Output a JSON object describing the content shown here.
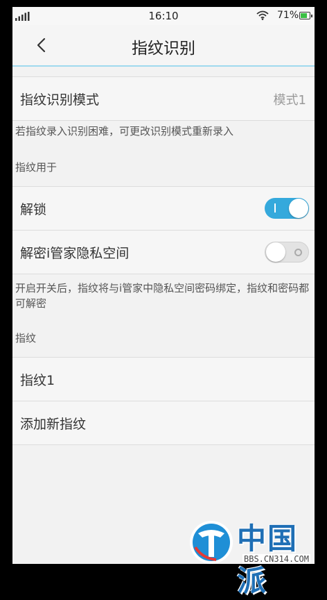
{
  "status_bar": {
    "time": "16:10",
    "battery": "71%",
    "signal_icon": "signal-icon",
    "wifi_icon": "wifi-icon"
  },
  "header": {
    "title": "指纹识别",
    "back_icon": "chevron-left-icon"
  },
  "mode": {
    "label": "指纹识别模式",
    "value": "模式1"
  },
  "mode_note": "若指纹录入识别困难，可更改识别模式重新录入",
  "usage": {
    "section_title": "指纹用于",
    "items": [
      {
        "label": "解锁",
        "enabled": true
      },
      {
        "label": "解密i管家隐私空间",
        "enabled": false
      }
    ],
    "note": "开启开关后，指纹将与i管家中隐私空间密码绑定，指纹和密码都可解密"
  },
  "fingerprints": {
    "section_title": "指纹",
    "items": [
      {
        "label": "指纹1"
      },
      {
        "label": "添加新指纹"
      }
    ]
  },
  "watermark": {
    "brand": "中国派",
    "url": "BBS.CN314.COM"
  },
  "colors": {
    "accent": "#35a9dc",
    "header_line": "#9fd9ee",
    "background": "#f2f2f2"
  }
}
